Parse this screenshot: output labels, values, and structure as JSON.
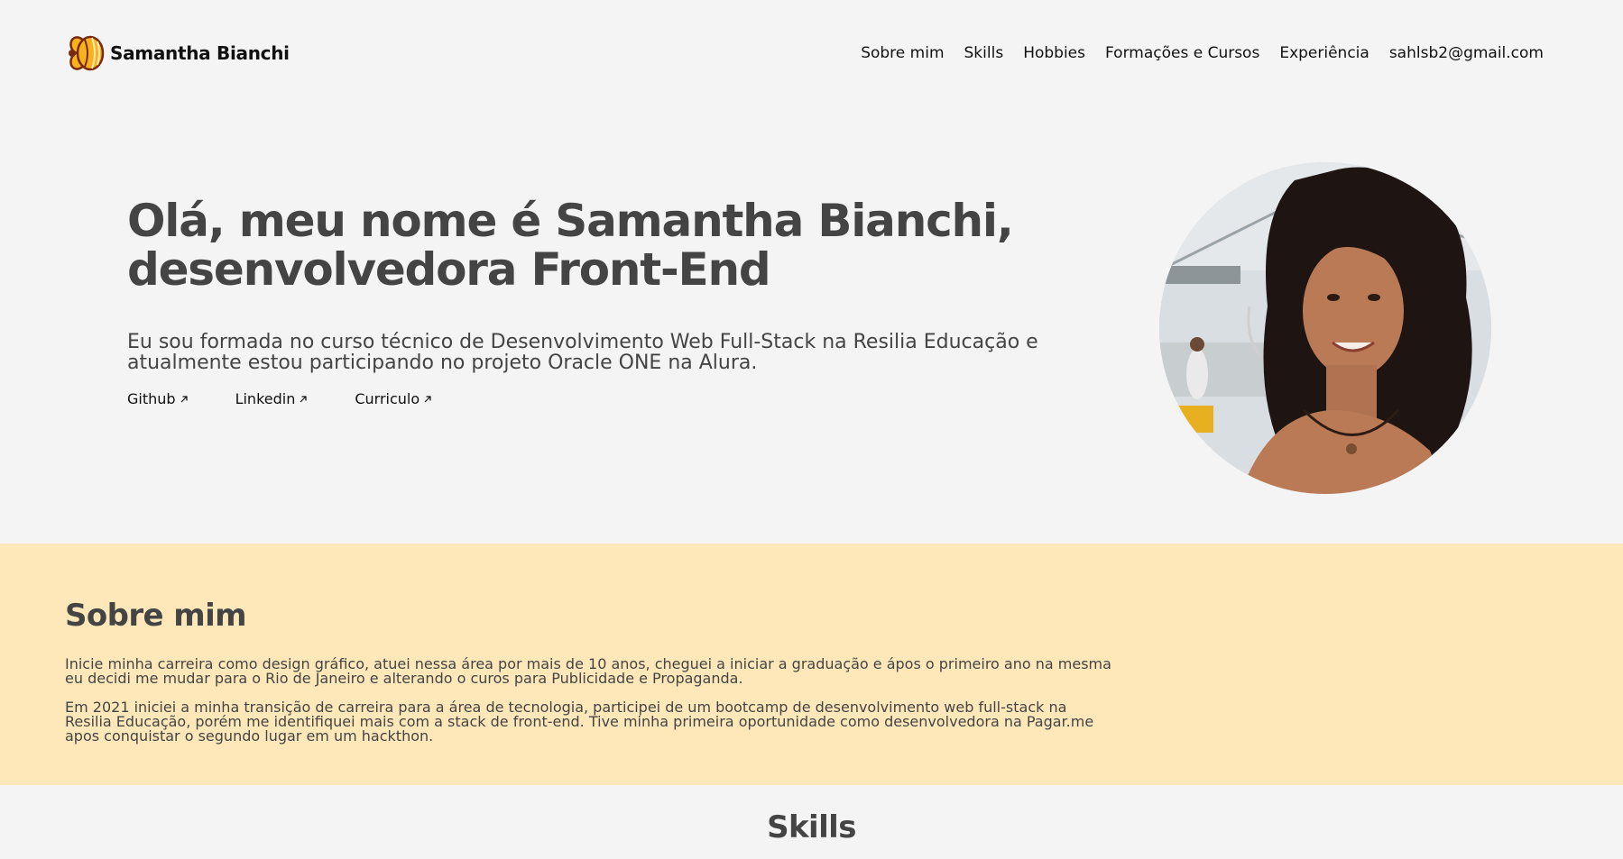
{
  "header": {
    "brand_name": "Samantha Bianchi",
    "logo_icon": "bee-icon",
    "nav": [
      {
        "label": "Sobre mim"
      },
      {
        "label": "Skills"
      },
      {
        "label": "Hobbies"
      },
      {
        "label": "Formações e Cursos"
      },
      {
        "label": "Experiência"
      },
      {
        "label": "sahlsb2@gmail.com"
      }
    ]
  },
  "hero": {
    "title": "Olá, meu nome é Samantha Bianchi, desenvolvedora Front-End",
    "text": "Eu sou formada no curso técnico de Desenvolvimento Web Full-Stack na Resilia Educação e atualmente estou participando no projeto Oracle ONE na Alura.",
    "links": [
      {
        "label": "Github",
        "icon": "external-arrow-icon"
      },
      {
        "label": "Linkedin",
        "icon": "external-arrow-icon"
      },
      {
        "label": "Curriculo",
        "icon": "external-arrow-icon"
      }
    ],
    "photo": "profile-photo"
  },
  "about": {
    "title": "Sobre mim",
    "paragraphs": [
      "Inicie minha carreira como design gráfico, atuei nessa área por mais de 10 anos, cheguei a iniciar a graduação e ápos o primeiro ano na mesma eu decidi me mudar para o Rio de Janeiro e alterando o curos para Publicidade e Propaganda.",
      "Em 2021 iniciei a minha transição de carreira para a área de tecnologia, participei de um bootcamp de desenvolvimento web full-stack na Resilia Educação, porém me identifiquei mais com a stack de front-end. Tive minha primeira oportunidade como desenvolvedora na Pagar.me apos conquistar o segundo lugar em um hackthon."
    ]
  },
  "skills": {
    "title": "Skills"
  },
  "colors": {
    "page_bg": "#f4f4f4",
    "about_bg": "#fee8b9",
    "heading": "#444444",
    "bee_yellow": "#f7b21e",
    "bee_outline": "#7a2a0c"
  }
}
